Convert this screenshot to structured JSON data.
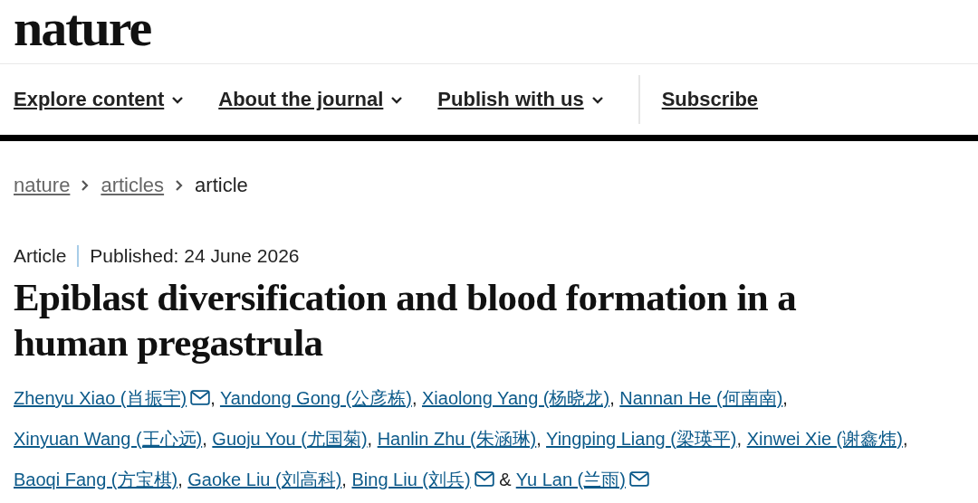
{
  "logo": "nature",
  "nav": [
    {
      "label": "Explore content",
      "dropdown": true
    },
    {
      "label": "About the journal",
      "dropdown": true
    },
    {
      "label": "Publish with us",
      "dropdown": true
    },
    {
      "label": "Subscribe",
      "dropdown": false
    }
  ],
  "breadcrumb": [
    {
      "label": "nature",
      "link": true
    },
    {
      "label": "articles",
      "link": true
    },
    {
      "label": "article",
      "link": false
    }
  ],
  "article": {
    "type": "Article",
    "published": "Published: 24 June 2026",
    "title": "Epiblast diversification and blood formation in a human pregastrula",
    "authors": [
      {
        "name": "Zhenyu Xiao  (肖振宇)",
        "email": true,
        "after": ", "
      },
      {
        "name": "Yandong Gong  (公彦栋)",
        "email": false,
        "after": ", "
      },
      {
        "name": "Xiaolong Yang  (杨晓龙)",
        "email": false,
        "after": ", "
      },
      {
        "name": "Nannan He  (何南南)",
        "email": false,
        "after": ", "
      },
      {
        "name": "Xinyuan Wang  (王心远)",
        "email": false,
        "after": ", "
      },
      {
        "name": "Guoju You  (尤国菊)",
        "email": false,
        "after": ", "
      },
      {
        "name": "Hanlin Zhu  (朱涵琳)",
        "email": false,
        "after": ", "
      },
      {
        "name": "Yingping Liang  (梁瑛平)",
        "email": false,
        "after": ", "
      },
      {
        "name": "Xinwei Xie (谢鑫炜)",
        "email": false,
        "after": ", "
      },
      {
        "name": "Baoqi Fang  (方宝棋)",
        "email": false,
        "after": ", "
      },
      {
        "name": "Gaoke Liu  (刘高科)",
        "email": false,
        "after": ", "
      },
      {
        "name": "Bing Liu  (刘兵)",
        "email": true,
        "after": " & "
      },
      {
        "name": "Yu Lan  (兰雨)",
        "email": true
      }
    ]
  }
}
